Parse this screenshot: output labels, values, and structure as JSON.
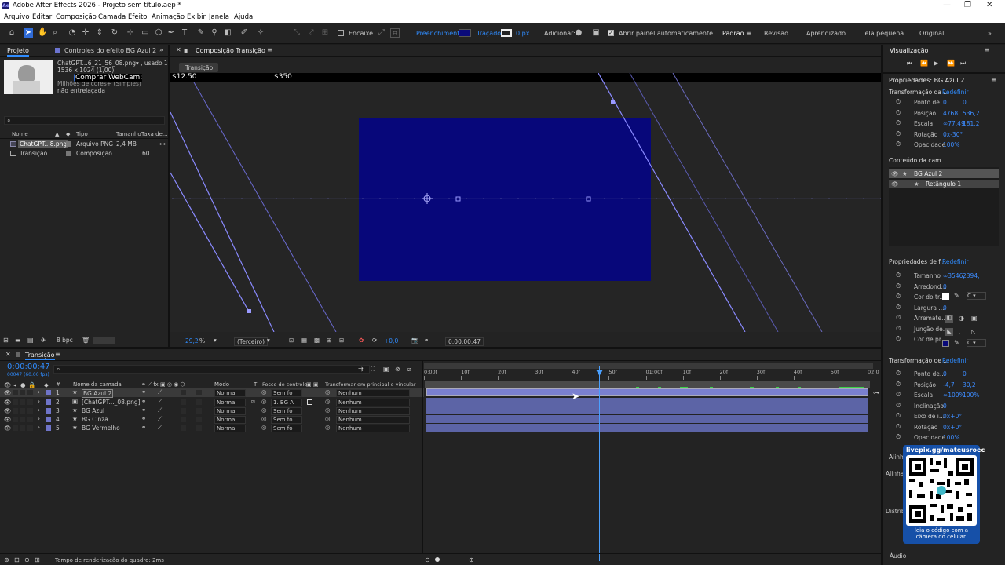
{
  "window": {
    "title": "Adobe After Effects 2026 - Projeto sem título.aep *",
    "logo": "Ae"
  },
  "menu": [
    "Arquivo",
    "Editar",
    "Composição",
    "Camada",
    "Efeito",
    "Animação",
    "Exibir",
    "Janela",
    "Ajuda"
  ],
  "toolbar": {
    "encaixe": "Encaixe",
    "fill_label": "Preenchimento:",
    "stroke_label": "Traçado:",
    "stroke_px": "0 px",
    "add_label": "Adicionar:",
    "auto_open": "Abrir painel automaticamente",
    "workspaces": [
      "Padrão",
      "Revisão",
      "Aprendizado",
      "Tela pequena",
      "Original"
    ],
    "fill_color": "#0a0a7a"
  },
  "project": {
    "tab": "Projeto",
    "effects_tab": "Controles do efeito BG Azul 2",
    "file_info": "ChatGPT...6_21_56_08.png▾ , usado 1 vez",
    "dimensions": "1536 x 1024 (1,00)",
    "colors": "Milhões de cores+ (Simples)",
    "interlace": "não entrelaçada",
    "webcam": "Comprar WebCam:",
    "columns": [
      "Nome",
      "Tipo",
      "Tamanho",
      "Taxa de..."
    ],
    "items": [
      {
        "name": "ChatGPT...8.png",
        "type": "Arquivo PNG",
        "size": "2,4 MB",
        "rate": ""
      },
      {
        "name": "Transição",
        "type": "Composição",
        "size": "",
        "rate": "60"
      }
    ],
    "bpc": "8 bpc"
  },
  "comp": {
    "tab": "Composição Transição",
    "subtab": "Transição",
    "price_left": "$12.50",
    "price_right": "$350",
    "zoom": "29,2",
    "zoom_unit": "%",
    "resolution": "(Terceiro)",
    "timecode": "0:00:00:47",
    "exposure": "+0,0"
  },
  "timeline": {
    "tab": "Transição",
    "timecode": "0:00:00:47",
    "fps": "00047 (60.00 fps)",
    "headers": [
      "#",
      "Nome da camada",
      "Modo",
      "T",
      "Fosco de controle",
      "Transformar em principal e vincular"
    ],
    "ruler": [
      "0:00f",
      "10f",
      "20f",
      "30f",
      "40f",
      "50f",
      "01:00f",
      "10f",
      "20f",
      "30f",
      "40f",
      "50f",
      "02:0"
    ],
    "layers": [
      {
        "num": "1",
        "name": "BG Azul 2",
        "mode": "Normal",
        "matte": "Sem fo",
        "parent": "Nenhum",
        "color": "#6f74c8"
      },
      {
        "num": "2",
        "name": "[ChatGPT..._08.png]",
        "mode": "Normal",
        "matte": "1. BG A",
        "parent": "Nenhum",
        "color": "#6f74c8"
      },
      {
        "num": "3",
        "name": "BG Azul",
        "mode": "Normal",
        "matte": "Sem fo",
        "parent": "Nenhum",
        "color": "#6f74c8"
      },
      {
        "num": "4",
        "name": "BG Cinza",
        "mode": "Normal",
        "matte": "Sem fo",
        "parent": "Nenhum",
        "color": "#6f74c8"
      },
      {
        "num": "5",
        "name": "BG Vermelho",
        "mode": "Normal",
        "matte": "Sem fo",
        "parent": "Nenhum",
        "color": "#6f74c8"
      }
    ],
    "render_time": "Tempo de renderização do quadro: 2ms"
  },
  "props": {
    "visualization": "Visualização",
    "title": "Propriedades: BG Azul 2",
    "transform_section": "Transformação da ...",
    "reset": "Redefinir",
    "transform": [
      {
        "label": "Ponto de...",
        "v1": "0",
        "v2": "0"
      },
      {
        "label": "Posição",
        "v1": "4768",
        "v2": "536,2"
      },
      {
        "label": "Escala",
        "v1": "∞77,49",
        "v2": "181,2"
      },
      {
        "label": "Rotação",
        "v1": "0x-30°",
        "v2": ""
      },
      {
        "label": "Opacidade",
        "v1": "100%",
        "v2": ""
      }
    ],
    "content_section": "Conteúdo da cam...",
    "content_items": [
      "BG Azul 2",
      "Retângulo 1"
    ],
    "shape_section": "Propriedades de f...",
    "shape": [
      {
        "label": "Tamanho",
        "v1": "∞3546,",
        "v2": "2394,"
      },
      {
        "label": "Arredond...",
        "v1": "0",
        "v2": ""
      },
      {
        "label": "Cor do tr...",
        "v1": "",
        "v2": ""
      },
      {
        "label": "Largura ...",
        "v1": "0",
        "v2": ""
      },
      {
        "label": "Arremate...",
        "v1": "",
        "v2": ""
      },
      {
        "label": "Junção de...",
        "v1": "",
        "v2": ""
      },
      {
        "label": "Cor de pr...",
        "v1": "",
        "v2": ""
      }
    ],
    "transform2_section": "Transformação de ...",
    "transform2": [
      {
        "label": "Ponto de...",
        "v1": "0",
        "v2": "0"
      },
      {
        "label": "Posição",
        "v1": "-4,7",
        "v2": "30,2"
      },
      {
        "label": "Escala",
        "v1": "∞100%",
        "v2": "100%"
      },
      {
        "label": "Inclinação",
        "v1": "0",
        "v2": ""
      },
      {
        "label": "Eixo de i...",
        "v1": "0x+0°",
        "v2": ""
      },
      {
        "label": "Rotação",
        "v1": "0x+0°",
        "v2": ""
      },
      {
        "label": "Opacidade",
        "v1": "100%",
        "v2": ""
      }
    ],
    "align": "Alinh",
    "align2": "Alinha",
    "distrib": "Distrib",
    "audio": "Áudio"
  },
  "overlay": {
    "url": "livepix.gg/mateusroec",
    "caption": "leia o código com a câmera do celular."
  }
}
